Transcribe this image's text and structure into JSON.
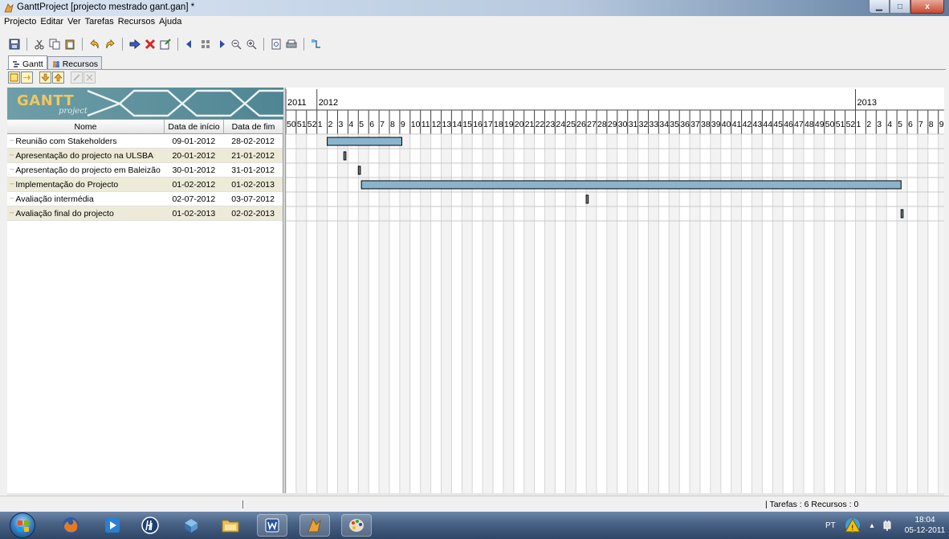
{
  "window": {
    "title": "GanttProject [projecto mestrado gant.gan] *",
    "minimize_glyph": "▁",
    "maximize_glyph": "□",
    "close_glyph": "x"
  },
  "menu": [
    "Projecto",
    "Editar",
    "Ver",
    "Tarefas",
    "Recursos",
    "Ajuda"
  ],
  "tabs": [
    {
      "label": "Gantt",
      "icon": "gantt-tab-icon",
      "active": true
    },
    {
      "label": "Recursos",
      "icon": "resources-tab-icon",
      "active": false
    }
  ],
  "logo": {
    "title": "GANTT",
    "subtitle": "project"
  },
  "grid": {
    "headers": {
      "name": "Nome",
      "start": "Data de início",
      "end": "Data de fim"
    },
    "tasks": [
      {
        "name": "Reunião com Stakeholders",
        "start": "09-01-2012",
        "end": "28-02-2012"
      },
      {
        "name": "Apresentação do projecto na ULSBA",
        "start": "20-01-2012",
        "end": "21-01-2012"
      },
      {
        "name": "Apresentação do projecto em Baleizão",
        "start": "30-01-2012",
        "end": "31-01-2012"
      },
      {
        "name": "Implementação do Projecto",
        "start": "01-02-2012",
        "end": "01-02-2013"
      },
      {
        "name": "Avaliação intermédia",
        "start": "02-07-2012",
        "end": "03-07-2012"
      },
      {
        "name": "Avaliação final do projecto",
        "start": "01-02-2013",
        "end": "02-02-2013"
      }
    ]
  },
  "timeline": {
    "years": [
      {
        "label": "2011",
        "week_index": 0
      },
      {
        "label": "2012",
        "week_index": 3
      },
      {
        "label": "2013",
        "week_index": 55
      }
    ],
    "weeks": [
      "50",
      "51",
      "52",
      "1",
      "2",
      "3",
      "4",
      "5",
      "6",
      "7",
      "8",
      "9",
      "10",
      "11",
      "12",
      "13",
      "14",
      "15",
      "16",
      "17",
      "18",
      "19",
      "20",
      "21",
      "22",
      "23",
      "24",
      "25",
      "26",
      "27",
      "28",
      "29",
      "30",
      "31",
      "32",
      "33",
      "34",
      "35",
      "36",
      "37",
      "38",
      "39",
      "40",
      "41",
      "42",
      "43",
      "44",
      "45",
      "46",
      "47",
      "48",
      "49",
      "50",
      "51",
      "52",
      "1",
      "2",
      "3",
      "4",
      "5",
      "6",
      "7",
      "8",
      "9"
    ],
    "bars": [
      {
        "task_index": 0,
        "start_week": 4.0,
        "end_week": 11.2,
        "milestone": false
      },
      {
        "task_index": 1,
        "start_week": 5.6,
        "end_week": 5.8,
        "milestone": true
      },
      {
        "task_index": 2,
        "start_week": 7.0,
        "end_week": 7.2,
        "milestone": true
      },
      {
        "task_index": 3,
        "start_week": 7.3,
        "end_week": 59.4,
        "milestone": false
      },
      {
        "task_index": 4,
        "start_week": 29.0,
        "end_week": 29.2,
        "milestone": true
      },
      {
        "task_index": 5,
        "start_week": 59.4,
        "end_week": 59.6,
        "milestone": true
      }
    ],
    "bar_color": "#8ab4cc"
  },
  "status": {
    "summary": "| Tarefas : 6  Recursos : 0"
  },
  "taskbar": {
    "lang": "PT",
    "time": "18:04",
    "date": "05-12-2011"
  }
}
